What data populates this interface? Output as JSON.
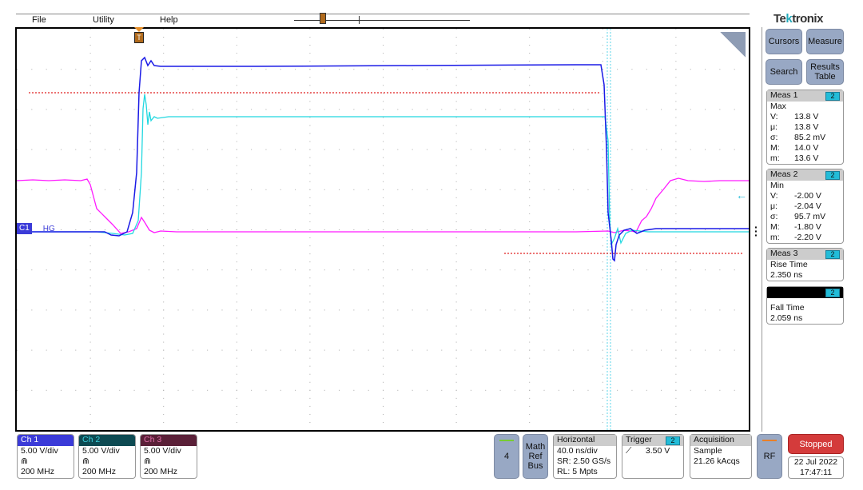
{
  "menu": {
    "file": "File",
    "utility": "Utility",
    "help": "Help"
  },
  "brand": {
    "pre": "Te",
    "accent": "k",
    "post": "tronix"
  },
  "trigger_marker": "T",
  "channel_label": {
    "ch": "C1",
    "name": "HG"
  },
  "side_buttons": {
    "cursors": "Cursors",
    "measure": "Measure",
    "search": "Search",
    "results": "Results Table"
  },
  "measurements": [
    {
      "title": "Meas 1",
      "source": "2",
      "type": "Max",
      "rows": [
        {
          "k": "V:",
          "v": "13.8 V"
        },
        {
          "k": "μ:",
          "v": "13.8 V"
        },
        {
          "k": "σ:",
          "v": "85.2 mV"
        },
        {
          "k": "M:",
          "v": "14.0 V"
        },
        {
          "k": "m:",
          "v": "13.6 V"
        }
      ]
    },
    {
      "title": "Meas 2",
      "source": "2",
      "type": "Min",
      "rows": [
        {
          "k": "V:",
          "v": "-2.00 V"
        },
        {
          "k": "μ:",
          "v": "-2.04 V"
        },
        {
          "k": "σ:",
          "v": "95.7 mV"
        },
        {
          "k": "M:",
          "v": "-1.80 V"
        },
        {
          "k": "m:",
          "v": "-2.20 V"
        }
      ]
    },
    {
      "title": "Meas 3",
      "source": "2",
      "type": "Rise Time",
      "value": "2.350 ns"
    },
    {
      "title": "",
      "source": "2",
      "type": "Fall Time",
      "value": "2.059 ns"
    }
  ],
  "channels": [
    {
      "name": "Ch 1",
      "scale": "5.00 V/div",
      "bw_icon": "bandwidth-limit-icon",
      "bw": "200 MHz",
      "color": "#3b3bd8"
    },
    {
      "name": "Ch 2",
      "scale": "5.00 V/div",
      "bw_icon": "bandwidth-limit-icon",
      "bw": "200 MHz",
      "color": "#0d4a52"
    },
    {
      "name": "Ch 3",
      "scale": "5.00 V/div",
      "bw_icon": "bandwidth-limit-icon",
      "bw": "200 MHz",
      "color": "#5a2038"
    }
  ],
  "bottom": {
    "ch4": "4",
    "math": "Math Ref Bus",
    "horizontal": {
      "title": "Horizontal",
      "scale": "40.0 ns/div",
      "sr": "SR: 2.50 GS/s",
      "rl": "RL: 5 Mpts"
    },
    "trigger": {
      "title": "Trigger",
      "source": "2",
      "level": "3.50 V",
      "slope_icon": "rising-edge-icon"
    },
    "acquisition": {
      "title": "Acquisition",
      "mode": "Sample",
      "count": "21.26 kAcqs"
    },
    "rf": "RF",
    "status": "Stopped",
    "date": "22 Jul 2022",
    "time": "17:47:11"
  },
  "colors": {
    "ch1": "#1a1ae6",
    "ch2": "#22d8e0",
    "ch3": "#ff1aff",
    "cursor": "#e02020",
    "stopped": "#d43b3b",
    "button": "#98a8c4"
  }
}
